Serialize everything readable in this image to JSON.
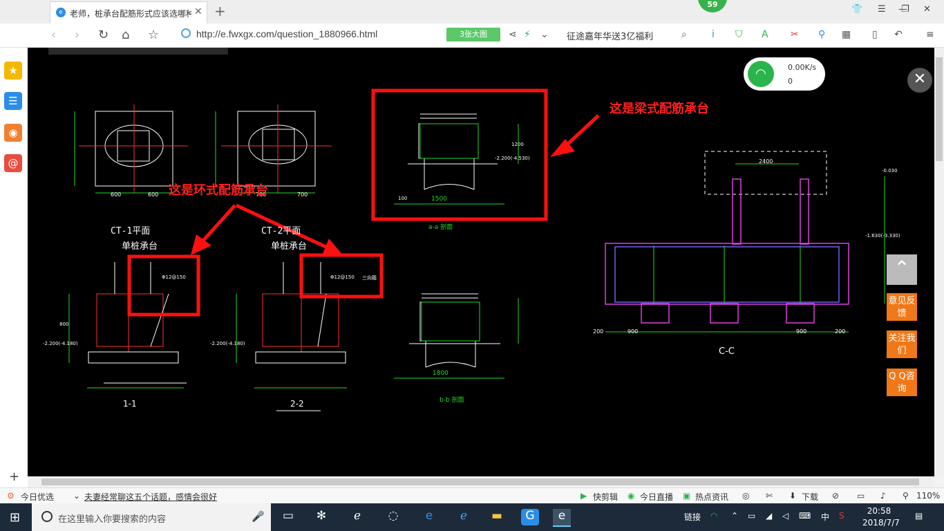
{
  "browser": {
    "tab_title": "老师，桩承台配筋形式应该选哪种",
    "notification_count": "59",
    "logo_glyph": "e"
  },
  "addressbar": {
    "url": "http://e.fwxgx.com/question_1880966.html",
    "big_image_button": "3张大图",
    "promo_text": "征途嘉年华送3亿福利"
  },
  "network_widget": {
    "speed": "0.00K/s",
    "count": "0"
  },
  "side_buttons": {
    "feedback": "意见反馈",
    "follow": "关注我们",
    "qq": "Q Q咨询"
  },
  "annotations": {
    "beam_type": "这是梁式配筋承台",
    "ring_type": "这是环式配筋承台"
  },
  "drawing": {
    "ct1_title": "CT-1平面",
    "ct1_sub": "单桩承台",
    "ct2_title": "CT-2平面",
    "ct2_sub": "单桩承台",
    "sec11": "1-1",
    "sec22": "2-2",
    "secaa": "a-a 剖面",
    "secbb": "b-b 剖面",
    "seccc": "C-C",
    "dim600a": "600",
    "dim600b": "600",
    "dim700a": "700",
    "dim700b": "700",
    "dim1500": "1500",
    "dim1800": "1800",
    "dim2400": "2400",
    "dim900a": "900",
    "dim900b": "900",
    "dim200a": "200",
    "dim200b": "200",
    "rebar1": "Φ12@150",
    "rebar2": "Φ12@150",
    "rebar3": "三向箍",
    "elev1": "-2.200(-4.530)",
    "elev2": "-2.200(-4.180)",
    "elev3": "-2.200(-4.180)",
    "elev4": "-0.030",
    "elev5": "-1.630(-3.330)",
    "dim800": "800",
    "dim1200": "1200",
    "dim100": "100"
  },
  "statusbar": {
    "news_label": "今日优选",
    "headline": "夫妻经常聊这五个话题，感情会很好",
    "kuaijianji": "快剪辑",
    "zhibo": "今日直播",
    "redian": "热点资讯",
    "download": "下载",
    "zoom": "110%"
  },
  "taskbar": {
    "search_placeholder": "在这里输入你要搜索的内容",
    "link_label": "链接",
    "ime": "中",
    "time": "20:58",
    "date": "2018/7/7"
  }
}
